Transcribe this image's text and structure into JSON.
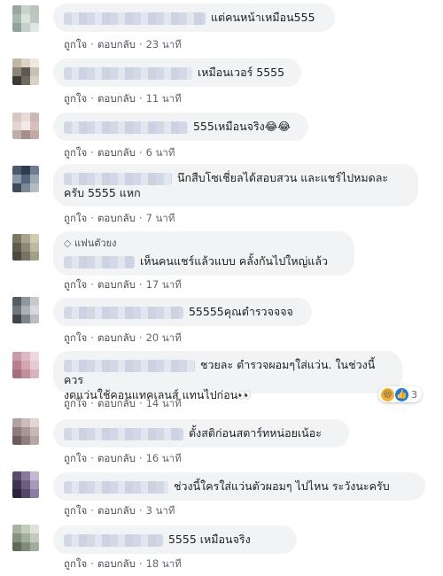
{
  "actions": {
    "like": "ถูกใจ",
    "reply": "ตอบกลับ",
    "separator": "·"
  },
  "comments": [
    {
      "text": "แต่คนหน้าเหมือน555",
      "time": "23 นาที"
    },
    {
      "text": "เหมือนเวอร์ 5555",
      "time": "11 นาที"
    },
    {
      "text": "555เหมือนจริง😂😂",
      "time": "6 นาที"
    },
    {
      "text_line1": "นึกสืบโซเชี่ยลได้สอบสวน และแชร์ไปหมดละ",
      "text_line2": "ครับ 5555 แหก",
      "time": "7 นาที"
    },
    {
      "badge": "แฟนตัวยง",
      "text": "เห็นคนแชร์แล้วแบบ คลั้งกันไปใหญ่แล้ว",
      "time": "17 นาที"
    },
    {
      "text": "55555คุณตำรวจจจจ",
      "time": "20 นาที"
    },
    {
      "text_line1": "ชวยละ ตำรวจผอมๆใส่แว่น. ในช่วงนี้ควร",
      "text_line2": "งดแว่นใช้คอนแทคเลนส์ แทนไปก่อน👀",
      "time": "14 นาที",
      "reaction_count": "3"
    },
    {
      "text": "ตั้งสติก่อนสตาร์ทหน่อยเน้อะ",
      "time": "16 นาที"
    },
    {
      "text": "ช่วงนี้ใครใส่แว่นตัวผอมๆ ไปไหน ระวังนะครับ",
      "time": "3 นาที"
    },
    {
      "text": "5555 เหมือนจริง",
      "time": "18 นาที"
    }
  ],
  "icons": [
    "diamond-icon",
    "haha-reaction-icon",
    "like-reaction-icon"
  ],
  "colors": {
    "bubble": "#f2f3f5",
    "meta": "#606770",
    "like_blue": "#1877f2",
    "haha_yellow": "#f7b125"
  }
}
